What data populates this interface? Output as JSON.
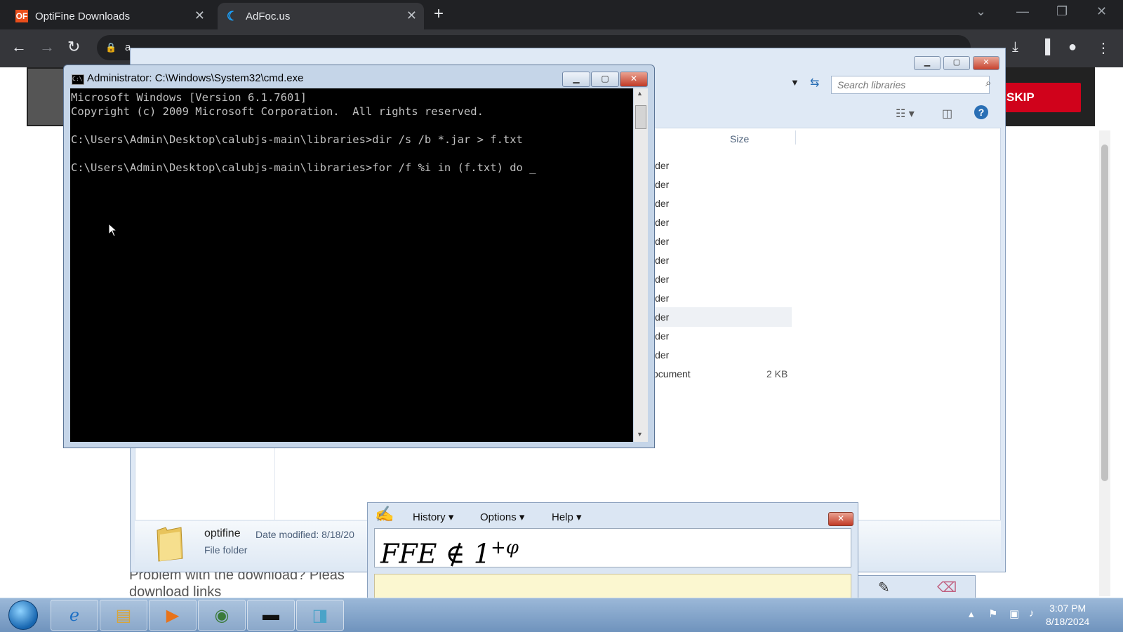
{
  "browser": {
    "tabs": [
      {
        "label": "OptiFine Downloads",
        "favicon": "OF"
      },
      {
        "label": "AdFoc.us"
      }
    ],
    "url_partial": "a"
  },
  "page": {
    "skip_label": "SKIP",
    "problem_text_line1": "Problem with the download? Pleas",
    "problem_text_line2": "download links"
  },
  "explorer": {
    "search_placeholder": "Search libraries",
    "column_size": "Size",
    "rows": [
      {
        "type": "lder",
        "size": ""
      },
      {
        "type": "lder",
        "size": ""
      },
      {
        "type": "lder",
        "size": ""
      },
      {
        "type": "lder",
        "size": ""
      },
      {
        "type": "lder",
        "size": ""
      },
      {
        "type": "lder",
        "size": ""
      },
      {
        "type": "lder",
        "size": ""
      },
      {
        "type": "lder",
        "size": ""
      },
      {
        "type": "lder",
        "size": ""
      },
      {
        "type": "lder",
        "size": ""
      },
      {
        "type": "lder",
        "size": ""
      },
      {
        "type": "ocument",
        "size": "2 KB"
      }
    ],
    "details": {
      "name": "optifine",
      "date_label": "Date modified: 8/18/20",
      "kind": "File folder"
    }
  },
  "cmd": {
    "title": "Administrator: C:\\Windows\\System32\\cmd.exe",
    "lines": [
      "Microsoft Windows [Version 6.1.7601]",
      "Copyright (c) 2009 Microsoft Corporation.  All rights reserved.",
      "",
      "C:\\Users\\Admin\\Desktop\\calubjs-main\\libraries>dir /s /b *.jar > f.txt",
      "",
      "C:\\Users\\Admin\\Desktop\\calubjs-main\\libraries>for /f %i in (f.txt) do _"
    ]
  },
  "math_panel": {
    "menus": [
      "History",
      "Options",
      "Help"
    ],
    "expression_main": "FFE ∉ 1",
    "expression_sup": "+φ"
  },
  "taskbar": {
    "time": "3:07 PM",
    "date": "8/18/2024"
  }
}
